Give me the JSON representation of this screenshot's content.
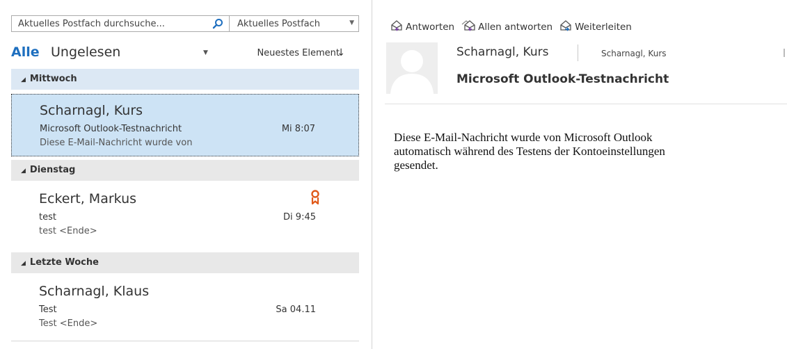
{
  "search": {
    "value": "Aktuelles Postfach durchsuche...",
    "scope": "Aktuelles Postfach"
  },
  "filters": {
    "all": "Alle",
    "unread": "Ungelesen",
    "sort": "Neuestes Element",
    "sort_arrow": "↓"
  },
  "groups": [
    {
      "label": "Mittwoch"
    },
    {
      "label": "Dienstag"
    },
    {
      "label": "Letzte Woche"
    }
  ],
  "mails": [
    {
      "sender": "Scharnagl, Kurs",
      "subject": "Microsoft Outlook-Testnachricht",
      "preview": "Diese E-Mail-Nachricht wurde von",
      "date": "Mi 8:07",
      "selected": true
    },
    {
      "sender": "Eckert, Markus",
      "subject": "test",
      "preview": "test <Ende>",
      "date": "Di 9:45",
      "icon": "award-ribbon-icon"
    },
    {
      "sender": "Scharnagl, Klaus",
      "subject": "Test",
      "preview": "Test <Ende>",
      "date": "Sa 04.11"
    }
  ],
  "toolbar": {
    "reply": "Antworten",
    "reply_all": "Allen antworten",
    "forward": "Weiterleiten"
  },
  "reading": {
    "sender_name": "Scharnagl, Kurs",
    "sender_address": "Scharnagl, Kurs",
    "subject": "Microsoft Outlook-Testnachricht",
    "body": "Diese E-Mail-Nachricht wurde von Microsoft Outlook\nautomatisch während des Testens der Kontoeinstellungen\ngesendet."
  },
  "colors": {
    "accent": "#1e6fbf",
    "selected_bg": "#cde3f5",
    "group_bg": "#e8e8e8",
    "flag": "#e05a1a"
  }
}
